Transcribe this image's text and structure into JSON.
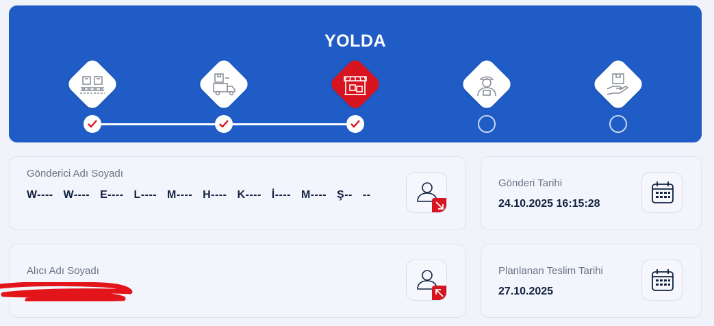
{
  "status": {
    "title": "YOLDA",
    "steps": [
      {
        "icon": "warehouse-conveyor-icon",
        "state": "done"
      },
      {
        "icon": "truck-loading-icon",
        "state": "done"
      },
      {
        "icon": "store-branch-icon",
        "state": "active"
      },
      {
        "icon": "courier-icon",
        "state": "todo"
      },
      {
        "icon": "package-hand-delivery-icon",
        "state": "todo"
      }
    ]
  },
  "sender": {
    "label": "Gönderici Adı Soyadı",
    "value": "W---- W---- E---- L---- M---- H---- K---- İ---- M---- Ş-- --"
  },
  "recipient": {
    "label": "Alıcı Adı Soyadı"
  },
  "ship_date": {
    "label": "Gönderi Tarihi",
    "value": "24.10.2025 16:15:28"
  },
  "planned_delivery": {
    "label": "Planlanan Teslim Tarihi",
    "value": "27.10.2025"
  },
  "colors": {
    "banner": "#1f5cc5",
    "active_step": "#d7141f",
    "check": "#d7141f",
    "text_dark": "#10213f",
    "text_muted": "#6b7384"
  }
}
